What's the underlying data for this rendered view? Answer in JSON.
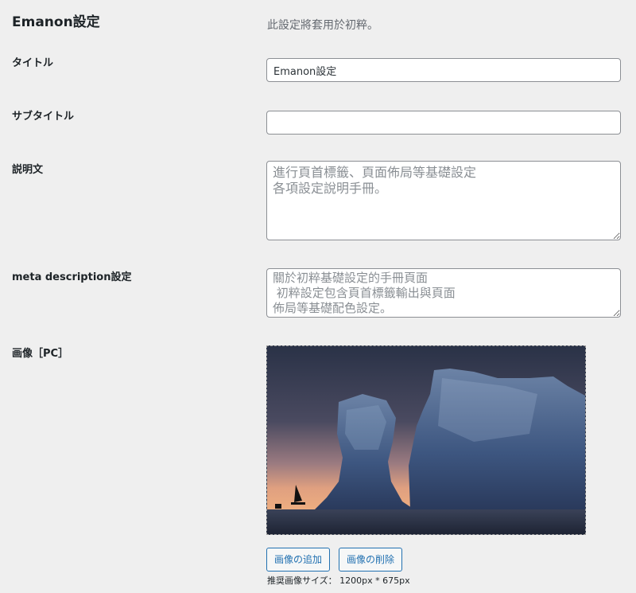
{
  "header": {
    "title": "Emanon設定",
    "description": "此設定將套用於初粹。"
  },
  "fields": {
    "title": {
      "label": "タイトル",
      "value": "Emanon設定"
    },
    "subtitle": {
      "label": "サブタイトル",
      "value": ""
    },
    "description": {
      "label": "説明文",
      "value": "進行頁首標籤、頁面佈局等基礎設定\n各項設定說明手冊。"
    },
    "meta_description": {
      "label": "meta description設定",
      "value": "關於初粹基礎設定的手冊頁面\n 初粹設定包含頁首標籤輸出與頁面\n佈局等基礎配色設定。"
    },
    "image_pc": {
      "label": "画像［PC］",
      "add_button": "画像の追加",
      "delete_button": "画像の削除",
      "recommended_size": "推奨画像サイズ： 1200px * 675px"
    }
  }
}
